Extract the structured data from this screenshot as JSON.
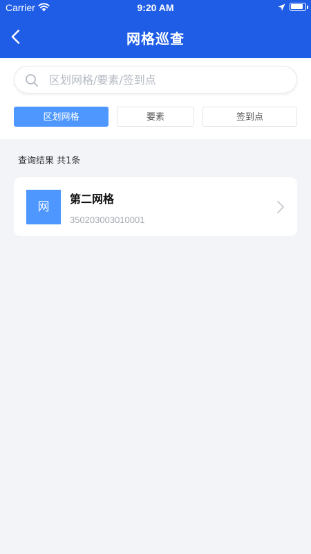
{
  "status_bar": {
    "carrier": "Carrier",
    "time": "9:20 AM",
    "battery_level": 0.95
  },
  "header": {
    "title": "网格巡查",
    "background": "#1f5de6",
    "back_icon": "chevron-left-icon"
  },
  "search": {
    "placeholder": "区划网格/要素/签到点",
    "value": "",
    "icon": "search-icon"
  },
  "tabs": [
    {
      "label": "区划网格",
      "active": true
    },
    {
      "label": "要素",
      "active": false
    },
    {
      "label": "签到点",
      "active": false
    }
  ],
  "results": {
    "summary": "查询结果 共1条",
    "items": [
      {
        "icon_text": "网",
        "name": "第二网格",
        "code": "350203003010001"
      }
    ]
  },
  "colors": {
    "accent": "#4d97ff",
    "header": "#1f5de6",
    "background": "#f3f4f8"
  }
}
